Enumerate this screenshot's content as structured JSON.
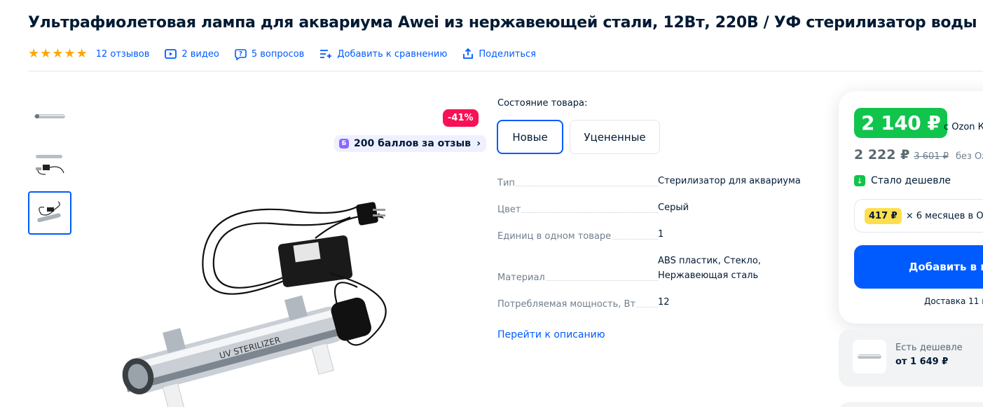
{
  "product": {
    "title": "Ультрафиолетовая лампа для аквариума Awei из нержавеющей стали, 12Вт, 220В / УФ стерилизатор воды"
  },
  "meta": {
    "rating": 5,
    "reviews": "12 отзывов",
    "videos": "2 видео",
    "questions": "5 вопросов",
    "compare": "Добавить к сравнению",
    "share": "Поделиться"
  },
  "gallery": {
    "discount": "-41%",
    "bonus": "200 баллов за отзыв",
    "bonus_badge": "Б"
  },
  "condition": {
    "label": "Состояние товара:",
    "options": [
      "Новые",
      "Уцененные"
    ],
    "selected": "Новые"
  },
  "specs": [
    {
      "key": "Тип",
      "value": "Стерилизатор для аквариума"
    },
    {
      "key": "Цвет",
      "value": "Серый"
    },
    {
      "key": "Единиц в одном товаре",
      "value": "1"
    },
    {
      "key": "Материал",
      "value": "ABS пластик, Стекло, Нержавеющая сталь"
    },
    {
      "key": "Потребляемая мощность, Вт",
      "value": "12"
    }
  ],
  "description_link": "Перейти к описанию",
  "buy": {
    "price_card": "2 140 ₽",
    "price_card_suffix": "с Ozon К",
    "price": "2 222 ₽",
    "old_price": "3 601 ₽",
    "without_card": "без Ozo",
    "cheaper": "Стало дешевле",
    "installment_amount": "417 ₽",
    "installment_text": "× 6 месяцев в Oz",
    "add_button": "Добавить в к",
    "delivery": "Доставка 11 н"
  },
  "cheaper_offer": {
    "label": "Есть дешевле",
    "price": "от 1 649 ₽"
  },
  "colors": {
    "accent": "#005bff",
    "green": "#10c44c",
    "discount": "#f91155",
    "star": "#ffa800"
  }
}
